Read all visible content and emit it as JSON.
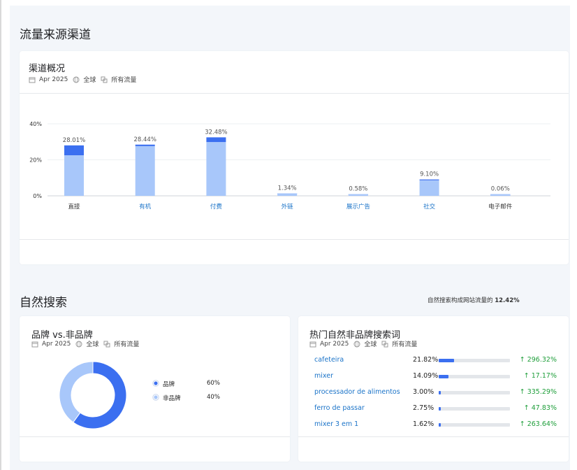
{
  "sections": {
    "traffic_title": "流量来源渠道",
    "organic_title": "自然搜索",
    "organic_note_prefix": "自然搜索构成网站流量的",
    "organic_note_value": "12.42%"
  },
  "overview_card": {
    "title": "渠道概况",
    "meta": {
      "date": "Apr 2025",
      "region": "全球",
      "traffic": "所有流量"
    }
  },
  "chart_data": {
    "type": "bar",
    "categories": [
      "直接",
      "有机",
      "付费",
      "外链",
      "展示广告",
      "社交",
      "电子邮件"
    ],
    "values": [
      28.01,
      28.44,
      32.48,
      1.34,
      0.58,
      9.1,
      0.06
    ],
    "value_labels": [
      "28.01%",
      "28.44%",
      "32.48%",
      "1.34%",
      "0.58%",
      "9.10%",
      "0.06%"
    ],
    "stack_lower": [
      22.5,
      27.6,
      29.8,
      0.9,
      0.4,
      8.6,
      0.04
    ],
    "category_colors": [
      "#333333",
      "#1a73c8",
      "#1a73c8",
      "#1a73c8",
      "#1a73c8",
      "#1a73c8",
      "#333333"
    ],
    "ylim": [
      0,
      40
    ],
    "yticks": [
      "0%",
      "20%",
      "40%"
    ],
    "ytick_values": [
      0,
      20,
      40
    ],
    "colors": {
      "upper": "#3b6ff0",
      "lower": "#a8c7fa"
    },
    "grid": true
  },
  "brand_card": {
    "title": "品牌 vs.非品牌",
    "meta": {
      "date": "Apr 2025",
      "region": "全球",
      "traffic": "所有流量"
    },
    "donut": [
      {
        "label": "品牌",
        "value": 60,
        "value_text": "60%",
        "color": "#3b6ff0"
      },
      {
        "label": "非品牌",
        "value": 40,
        "value_text": "40%",
        "color": "#a8c7fa"
      }
    ]
  },
  "keywords_card": {
    "title": "热门自然非品牌搜索词",
    "meta": {
      "date": "Apr 2025",
      "region": "全球",
      "traffic": "所有流量"
    },
    "rows": [
      {
        "keyword": "cafeteira",
        "share": "21.82%",
        "share_value": 21.82,
        "change": "296.32%"
      },
      {
        "keyword": "mixer",
        "share": "14.09%",
        "share_value": 14.09,
        "change": "17.17%"
      },
      {
        "keyword": "processador de alimentos",
        "share": "3.00%",
        "share_value": 3.0,
        "change": "335.29%"
      },
      {
        "keyword": "ferro de passar",
        "share": "2.75%",
        "share_value": 2.75,
        "change": "47.83%"
      },
      {
        "keyword": "mixer 3 em 1",
        "share": "1.62%",
        "share_value": 1.62,
        "change": "263.64%"
      }
    ],
    "up_arrow": "↑"
  }
}
